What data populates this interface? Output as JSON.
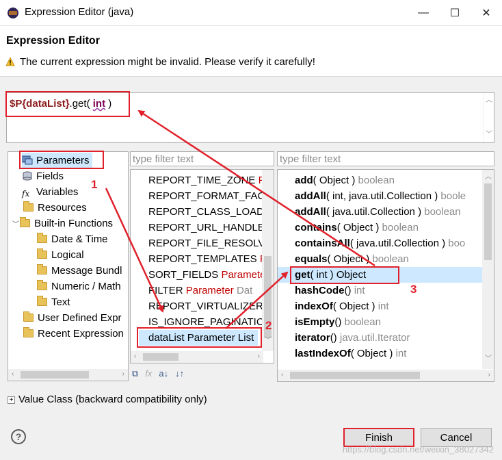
{
  "window": {
    "title": "Expression Editor (java)",
    "controls": [
      "—",
      "☐",
      "✕"
    ]
  },
  "header": {
    "title": "Expression Editor",
    "warning": "The current expression might be invalid. Please verify it carefully!"
  },
  "editor": {
    "param": "$P{dataList}",
    "mid": ".get( ",
    "keyword": "int",
    "end": " )"
  },
  "filters": {
    "middle_placeholder": "type filter text",
    "right_placeholder": "type filter text"
  },
  "tree": {
    "items": [
      {
        "label": "Parameters",
        "icon": "parameters-icon"
      },
      {
        "label": "Fields",
        "icon": "fields-icon"
      },
      {
        "label": "Variables",
        "icon": "fx-icon"
      },
      {
        "label": "Resources",
        "icon": "folder-icon"
      },
      {
        "label": "Built-in Functions",
        "icon": "folder-icon"
      },
      {
        "label": "Date & Time",
        "icon": "folder-icon"
      },
      {
        "label": "Logical",
        "icon": "folder-icon"
      },
      {
        "label": "Message Bundl",
        "icon": "folder-icon"
      },
      {
        "label": "Numeric / Math",
        "icon": "folder-icon"
      },
      {
        "label": "Text",
        "icon": "folder-icon"
      },
      {
        "label": "User Defined Expr",
        "icon": "folder-icon"
      },
      {
        "label": "Recent Expression",
        "icon": "folder-icon"
      }
    ]
  },
  "middle_list": {
    "items": [
      {
        "name": "REPORT_TIME_ZONE",
        "type": "P"
      },
      {
        "name": "REPORT_FORMAT_FAC",
        "type": ""
      },
      {
        "name": "REPORT_CLASS_LOAD",
        "type": ""
      },
      {
        "name": "REPORT_URL_HANDLE",
        "type": ""
      },
      {
        "name": "REPORT_FILE_RESOLVE",
        "type": ""
      },
      {
        "name": "REPORT_TEMPLATES",
        "type": "P"
      },
      {
        "name": "SORT_FIELDS",
        "type": "Paramete"
      },
      {
        "name": "FILTER",
        "type": "Parameter",
        "extra": "Dat"
      },
      {
        "name": "REPORT_VIRTUALIZER",
        "type": ""
      },
      {
        "name": "IS_IGNORE_PAGINATIC",
        "type": ""
      },
      {
        "name": "dataList",
        "type": "Parameter",
        "extra": "List"
      }
    ]
  },
  "methods": {
    "items": [
      {
        "name": "add",
        "args": "( Object )",
        "ret": "boolean"
      },
      {
        "name": "addAll",
        "args": "( int, java.util.Collection )",
        "ret": "boole"
      },
      {
        "name": "addAll",
        "args": "( java.util.Collection )",
        "ret": "boolean"
      },
      {
        "name": "contains",
        "args": "( Object )",
        "ret": "boolean"
      },
      {
        "name": "containsAll",
        "args": "( java.util.Collection )",
        "ret": "boo"
      },
      {
        "name": "equals",
        "args": "( Object )",
        "ret": "boolean"
      },
      {
        "name": "get",
        "args": "( int )",
        "ret": "Object"
      },
      {
        "name": "hashCode",
        "args": "()",
        "ret": "int"
      },
      {
        "name": "indexOf",
        "args": "( Object )",
        "ret": "int"
      },
      {
        "name": "isEmpty",
        "args": "()",
        "ret": "boolean"
      },
      {
        "name": "iterator",
        "args": "()",
        "ret": "java.util.Iterator"
      },
      {
        "name": "lastIndexOf",
        "args": "( Object )",
        "ret": "int"
      }
    ]
  },
  "value_class": {
    "label": "Value Class (backward compatibility only)"
  },
  "buttons": {
    "help": "?",
    "finish": "Finish",
    "cancel": "Cancel"
  },
  "annotations": {
    "n1": "1",
    "n2": "2",
    "n3": "3"
  },
  "watermark": "https://blog.csdn.net/weixin_38027342",
  "colors": {
    "annotation_red": "#e0202a",
    "selection": "#cde8ff",
    "param_red": "#c00000"
  }
}
